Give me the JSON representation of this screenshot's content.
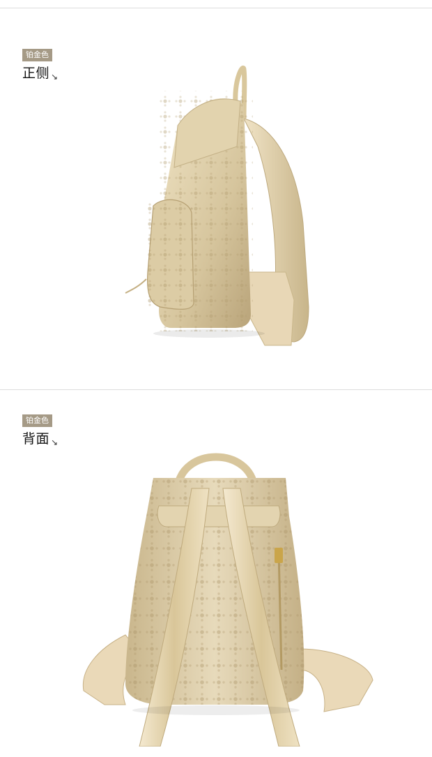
{
  "sections": [
    {
      "color_tag": "铂金色",
      "view_title": "正侧",
      "arrow_icon": "corner-arrow-icon"
    },
    {
      "color_tag": "铂金色",
      "view_title": "背面",
      "arrow_icon": "corner-arrow-icon"
    }
  ],
  "colors": {
    "tag_background": "#a59a86",
    "bag_gold": "#d8c9a4",
    "bag_shadow": "#b8a57a",
    "strap_gold": "#e6d6b2"
  }
}
